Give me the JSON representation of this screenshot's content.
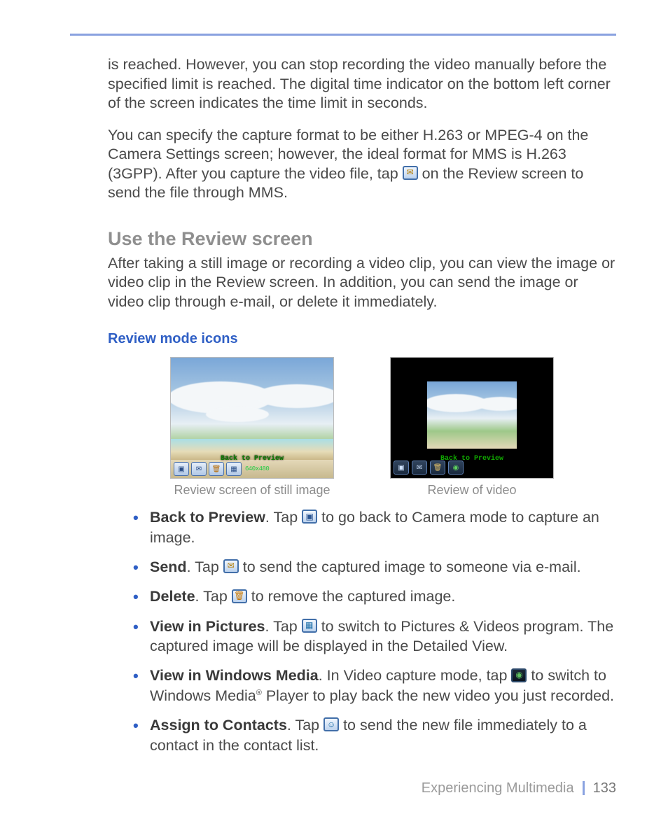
{
  "paragraphs": {
    "p1": "is reached. However, you can stop recording the video manually before the specified limit is reached. The digital time indicator on the bottom left corner of the screen indicates the time limit in seconds.",
    "p2a": "You can specify the capture format to be either H.263 or MPEG-4 on the Camera Settings screen; however, the ideal format for MMS is H.263 (3GPP). After you capture the video file, tap ",
    "p2b": " on the Review screen to send the file through MMS."
  },
  "headings": {
    "use_review": "Use the Review screen",
    "review_icons": "Review mode icons"
  },
  "review_intro": "After taking a still image or recording a video clip, you can view the image or video clip in the Review screen. In addition, you can send the image or video clip through e-mail, or delete it immediately.",
  "figures": {
    "still_caption": "Review screen of still image",
    "video_caption": "Review of video",
    "toolbar_label": "Back to Preview",
    "still_meta": "640x480"
  },
  "bullets": {
    "back": {
      "title": "Back to Preview",
      "pre": ". Tap ",
      "post": " to go back to Camera mode to capture an image."
    },
    "send": {
      "title": "Send",
      "pre": ". Tap ",
      "post": " to send the captured image to someone via e-mail."
    },
    "delete": {
      "title": "Delete",
      "pre": ". Tap ",
      "post": " to remove the captured image."
    },
    "view_pics": {
      "title": "View in Pictures",
      "pre": ". Tap ",
      "post": " to switch to Pictures & Videos program. The captured image will be displayed in the Detailed View."
    },
    "view_wm": {
      "title": "View in Windows Media",
      "pre": ". In Video capture mode, tap ",
      "post_a": " to switch to Windows Media",
      "reg": "®",
      "post_b": " Player to play back the new video you just recorded."
    },
    "assign": {
      "title": "Assign to Contacts",
      "pre": ". Tap ",
      "post": " to send the new file immediately to a contact in the contact list."
    }
  },
  "footer": {
    "section": "Experiencing Multimedia",
    "page": "133"
  }
}
